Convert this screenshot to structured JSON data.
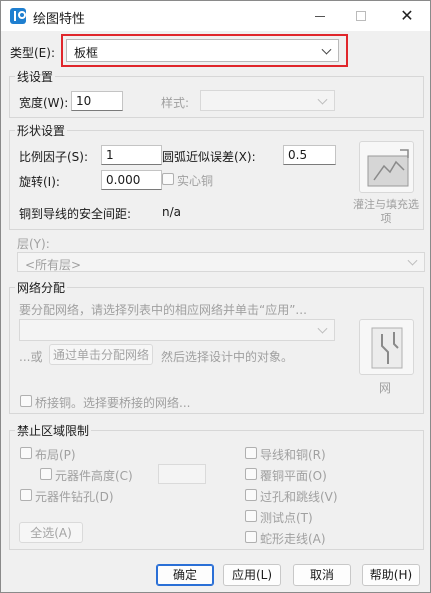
{
  "window": {
    "title": "绘图特性",
    "minimize_icon": "minimize-icon",
    "maximize_icon": "maximize-icon",
    "close_icon": "close-icon"
  },
  "type_field": {
    "label": "类型(E):",
    "value": "板框"
  },
  "line_settings": {
    "legend": "线设置",
    "width_label": "宽度(W):",
    "width_value": "10",
    "style_label": "样式:",
    "style_value": ""
  },
  "shape_settings": {
    "legend": "形状设置",
    "scale_label": "比例因子(S):",
    "scale_value": "1",
    "arc_error_label": "圆弧近似误差(X):",
    "arc_error_value": "0.5",
    "rotation_label": "旋转(I):",
    "rotation_value": "0.000",
    "solid_copper_label": "实心铜",
    "clearance_label": "铜到导线的安全间距:",
    "clearance_value": "n/a",
    "fill_button_label": "灌注与填充选项"
  },
  "layer": {
    "label": "层(Y):",
    "value": "<所有层>"
  },
  "net_assignment": {
    "legend": "网络分配",
    "hint": "要分配网络，请选择列表中的相应网络并单击“应用”...",
    "net_value": "",
    "or_text": "...或",
    "click_assign_label": "通过单击分配网络",
    "after_text": "然后选择设计中的对象。",
    "net_button_label": "网",
    "bridge_label": "桥接铜。选择要桥接的网络..."
  },
  "keepout": {
    "legend": "禁止区域限制",
    "placement_label": "布局(P)",
    "component_height_label": "元器件高度(C)",
    "component_height_value": "",
    "drill_label": "元器件钻孔(D)",
    "trace_copper_label": "导线和铜(R)",
    "plane_label": "覆铜平面(O)",
    "via_label": "过孔和跳线(V)",
    "testpoint_label": "测试点(T)",
    "serpentine_label": "蛇形走线(A)",
    "select_all_label": "全选(A)"
  },
  "footer": {
    "ok_label": "确定",
    "apply_label": "应用(L)",
    "cancel_label": "取消",
    "help_label": "帮助(H)"
  },
  "colors": {
    "accent": "#2a6fd6",
    "highlight": "#e0262b"
  }
}
